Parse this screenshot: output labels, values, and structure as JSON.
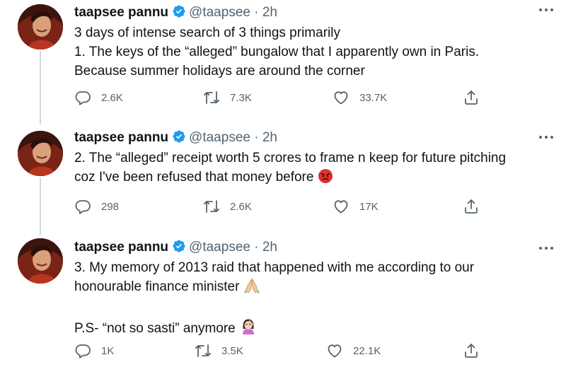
{
  "tweets": [
    {
      "name": "taapsee pannu",
      "handle": "@taapsee",
      "separator": "·",
      "time": "2h",
      "lines": [
        "3 days of intense search of 3 things primarily",
        "1. The keys of the “alleged” bungalow that I apparently own in Paris.",
        "Because summer holidays are around the corner"
      ],
      "replies": "2.6K",
      "retweets": "7.3K",
      "likes": "33.7K"
    },
    {
      "name": "taapsee pannu",
      "handle": "@taapsee",
      "separator": "·",
      "time": "2h",
      "lines": [
        "2. The “alleged” receipt worth 5 crores to frame n keep for future pitching",
        "coz I've been refused that money before"
      ],
      "replies": "298",
      "retweets": "2.6K",
      "likes": "17K"
    },
    {
      "name": "taapsee pannu",
      "handle": "@taapsee",
      "separator": "·",
      "time": "2h",
      "lines": [
        "3. My memory of 2013 raid that happened with me according to our",
        "honourable finance minister",
        "P.S- “not so sasti” anymore"
      ],
      "replies": "1K",
      "retweets": "3.5K",
      "likes": "22.1K"
    }
  ],
  "icons": {
    "verified": "verified-badge-icon",
    "more": "more-options-icon",
    "reply": "reply-icon",
    "retweet": "retweet-icon",
    "like": "like-icon",
    "share": "share-icon",
    "emoji_tweet2": "angry-face-emoji",
    "emoji_tweet3a": "folded-hands-emoji",
    "emoji_tweet3b": "person-facepalming-emoji"
  },
  "colors": {
    "text": "#0f1419",
    "secondary": "#536471",
    "verified": "#1d9bf0",
    "thread_line": "#cfd9de"
  }
}
